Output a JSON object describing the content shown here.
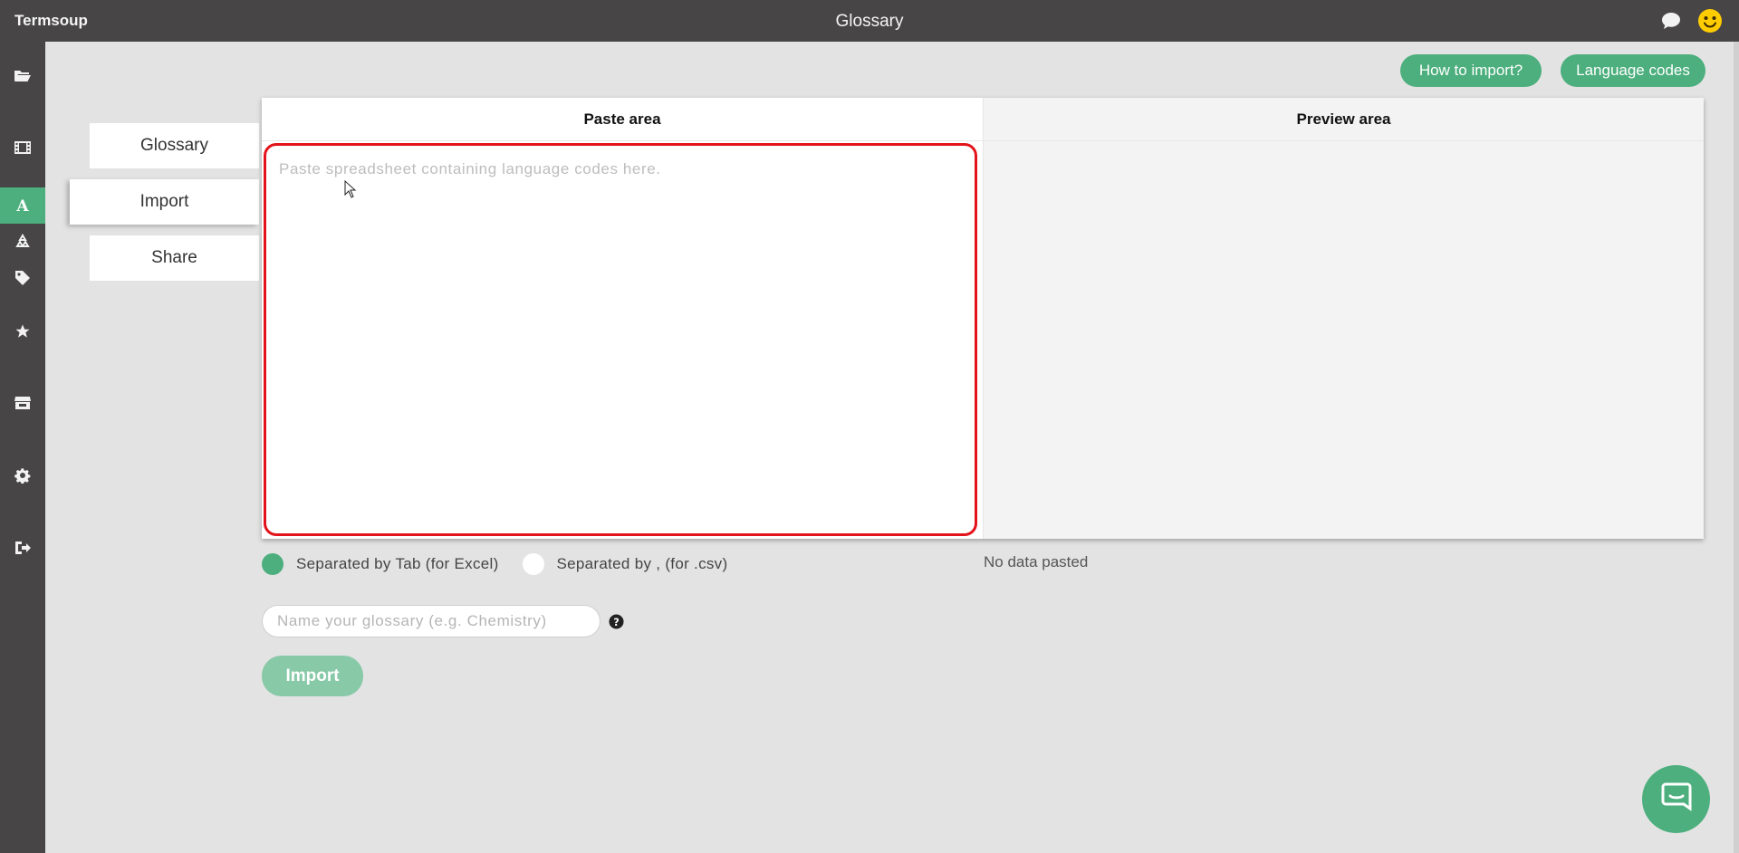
{
  "app": {
    "brand": "Termsoup",
    "title": "Glossary"
  },
  "header_icons": [
    "chat-bubble-icon",
    "smiley-face-icon"
  ],
  "sidebar": {
    "items": [
      {
        "icon": "folder-open-icon"
      },
      {
        "icon": "film-icon"
      },
      {
        "icon": "glossary-a-icon",
        "active": true
      },
      {
        "icon": "recycle-icon"
      },
      {
        "icon": "tag-icon"
      },
      {
        "icon": "star-icon"
      },
      {
        "icon": "store-icon"
      },
      {
        "icon": "gear-icon"
      },
      {
        "icon": "sign-out-icon"
      }
    ]
  },
  "actions": {
    "how_to_import": "How to import?",
    "language_codes": "Language codes"
  },
  "tabs": {
    "glossary": "Glossary",
    "import": "Import",
    "share": "Share"
  },
  "panel": {
    "paste_header": "Paste area",
    "preview_header": "Preview area",
    "paste_placeholder": "Paste spreadsheet containing language codes here."
  },
  "separator": {
    "tab_label": "Separated by Tab (for Excel)",
    "comma_label": "Separated by , (for .csv)",
    "selected": "tab"
  },
  "preview_status": "No data pasted",
  "glossary_name": {
    "placeholder": "Name your glossary (e.g. Chemistry)",
    "value": ""
  },
  "import_button": "Import",
  "colors": {
    "accent": "#4caf7d",
    "topbar": "#474546",
    "highlight_border": "#e3131b"
  }
}
